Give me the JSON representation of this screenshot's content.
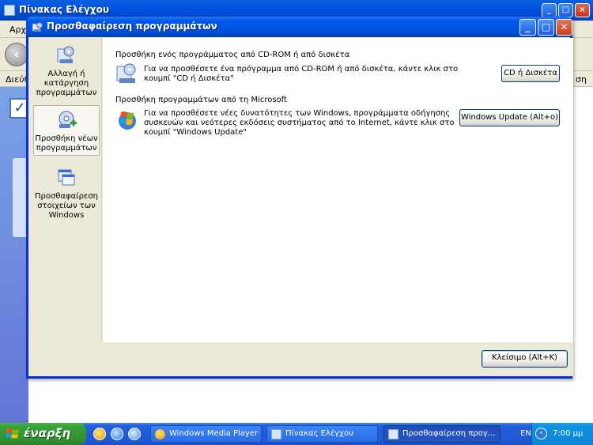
{
  "background_window": {
    "title": "Πίνακας Ελέγχου",
    "menu_partial": "Αρχ",
    "address_partial": "Διεύθ",
    "address_right_partial": "ση"
  },
  "dialog": {
    "title": "Προσθαφαίρεση προγραμμάτων",
    "tasks": [
      {
        "label": "Αλλαγή ή κατάργηση προγραμμάτων",
        "icon": "change-remove-programs-icon"
      },
      {
        "label": "Προσθήκη νέων προγραμμάτων",
        "icon": "add-new-programs-icon",
        "active": true
      },
      {
        "label": "Προσθαφαίρεση στοιχείων των Windows",
        "icon": "windows-components-icon"
      }
    ],
    "sections": [
      {
        "heading": "Προσθήκη ενός προγράμματος από CD-ROM ή από δισκέτα",
        "text": "Για να προσθέσετε ένα πρόγραμμα από CD-ROM ή από δισκέτα, κάντε κλικ στο κουμπί \"CD ή Δισκέτα\"",
        "button": "CD ή Δισκέτα",
        "icon": "cd-install-icon"
      },
      {
        "heading": "Προσθήκη προγραμμάτων από τη Microsoft",
        "text": "Για να προσθέσετε νέες δυνατότητες των Windows, προγράμματα οδήγησης συσκευών και νεότερες εκδόσεις συστήματος από το Internet, κάντε κλικ στο κουμπί \"Windows Update\"",
        "button": "Windows Update (Alt+o)",
        "icon": "windows-update-icon"
      }
    ],
    "close_button": "Κλείσιμο (Alt+K)"
  },
  "taskbar": {
    "start_label": "έναρξη",
    "items": [
      {
        "label": "Windows Media Player",
        "icon": "media-player-icon"
      },
      {
        "label": "Πίνακας Ελέγχου",
        "icon": "control-panel-icon"
      },
      {
        "label": "Προσθαφαίρεση προγ…",
        "icon": "add-remove-programs-icon",
        "active": true
      }
    ],
    "language": "EN",
    "clock": "7:00 μμ"
  },
  "colors": {
    "titlebar": "#0054e3",
    "dialog_face": "#ece9d8",
    "taskbar": "#245edb",
    "start": "#37a037",
    "close_red": "#c9401f"
  }
}
